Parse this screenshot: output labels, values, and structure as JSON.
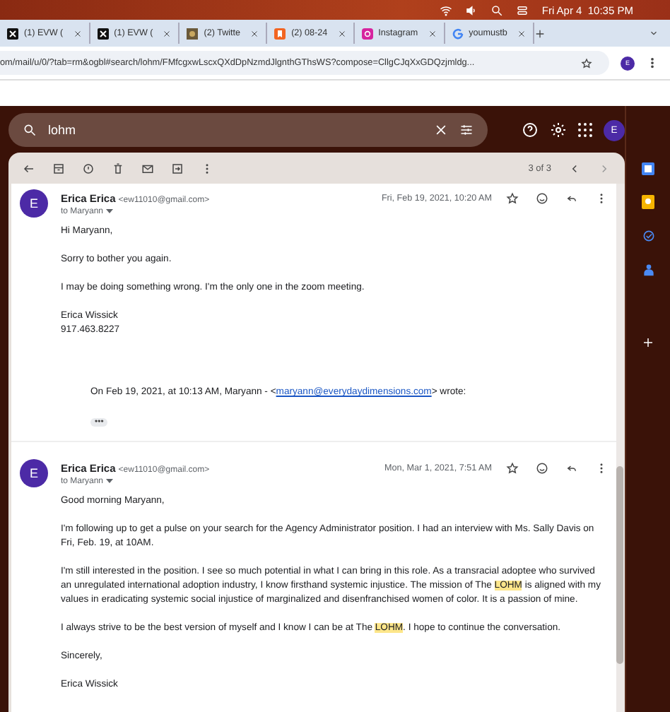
{
  "menu_bar": {
    "clock": "Fri Apr 4  10:35 PM"
  },
  "tabs": [
    {
      "title": "(1) EVW (",
      "selected": false
    },
    {
      "title": "(1) EVW (",
      "selected": false
    },
    {
      "title": "(2) Twitte",
      "selected": false
    },
    {
      "title": "(2) 08-24",
      "selected": false
    },
    {
      "title": "Instagram",
      "selected": false
    },
    {
      "title": "youmustb",
      "selected": false
    }
  ],
  "address_bar": {
    "url": "om/mail/u/0/?tab=rm&ogbl#search/lohm/FMfcgxwLscxQXdDpNzmdJlgnthGThsWS?compose=CllgCJqXxGDQzjmldg...",
    "avatar": "E"
  },
  "search": {
    "value": "lohm"
  },
  "account_avatar": "E",
  "pager": "3 of 3",
  "messages": [
    {
      "avatar": "E",
      "sender": "Erica Erica",
      "email": "<ew11010@gmail.com>",
      "to": "to Maryann",
      "date": "Fri, Feb 19, 2021, 10:20 AM",
      "starred": false,
      "paragraphs": [
        [
          {
            "kind": "text",
            "text": "Hi Maryann,"
          }
        ],
        [
          {
            "kind": "text",
            "text": "Sorry to bother you again."
          }
        ],
        [
          {
            "kind": "text",
            "text": "I may be doing something wrong. I'm the only one in the zoom meeting."
          }
        ],
        [
          {
            "kind": "text",
            "text": "Erica Wissick\n917.463.8227"
          }
        ]
      ],
      "quote": [
        {
          "kind": "text",
          "text": "On Feb 19, 2021, at 10:13 AM, Maryann - <"
        },
        {
          "kind": "link",
          "text": "maryann@everydaydimensions.com"
        },
        {
          "kind": "text",
          "text": "> wrote:"
        }
      ],
      "quote_more": "•••"
    },
    {
      "avatar": "E",
      "sender": "Erica Erica",
      "email": "<ew11010@gmail.com>",
      "to": "to Maryann",
      "date": "Mon, Mar 1, 2021, 7:51 AM",
      "starred": false,
      "paragraphs": [
        [
          {
            "kind": "text",
            "text": "Good morning Maryann,"
          }
        ],
        [
          {
            "kind": "text",
            "text": "I'm following up to get a pulse on your search for the Agency Administrator position. I had an interview with Ms. Sally Davis on Fri, Feb. 19, at 10AM."
          }
        ],
        [
          {
            "kind": "text",
            "text": "I'm still interested in the position. I see so much potential in what I can bring in this role. As a transracial adoptee who survived an unregulated international adoption industry, I know firsthand systemic injustice. The mission of The "
          },
          {
            "kind": "highlight",
            "text": "LOHM"
          },
          {
            "kind": "text",
            "text": " is aligned with my values in eradicating systemic social injustice of marginalized and disenfranchised women of color. It is a passion of mine."
          }
        ],
        [
          {
            "kind": "text",
            "text": "I always strive to be the best version of myself and I know I can be at The "
          },
          {
            "kind": "highlight",
            "text": "LOHM"
          },
          {
            "kind": "text",
            "text": ". I hope to continue the conversation."
          }
        ],
        [
          {
            "kind": "text",
            "text": "Sincerely,"
          }
        ],
        [
          {
            "kind": "text",
            "text": "Erica Wissick"
          }
        ]
      ]
    }
  ]
}
